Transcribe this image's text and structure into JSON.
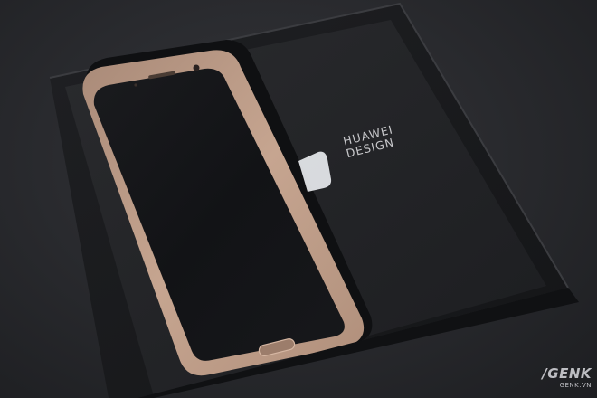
{
  "box_print": {
    "line1": "HUAWEI",
    "line2": "DESIGN"
  },
  "watermark": {
    "logo": "/GENK",
    "domain": "GENK.VN"
  },
  "colors": {
    "background": "#2a2b2f",
    "box_interior": "#1b1c1f",
    "phone_frame": "#c9a68f",
    "phone_screen": "#111214",
    "box_print": "#d9d9dc"
  }
}
